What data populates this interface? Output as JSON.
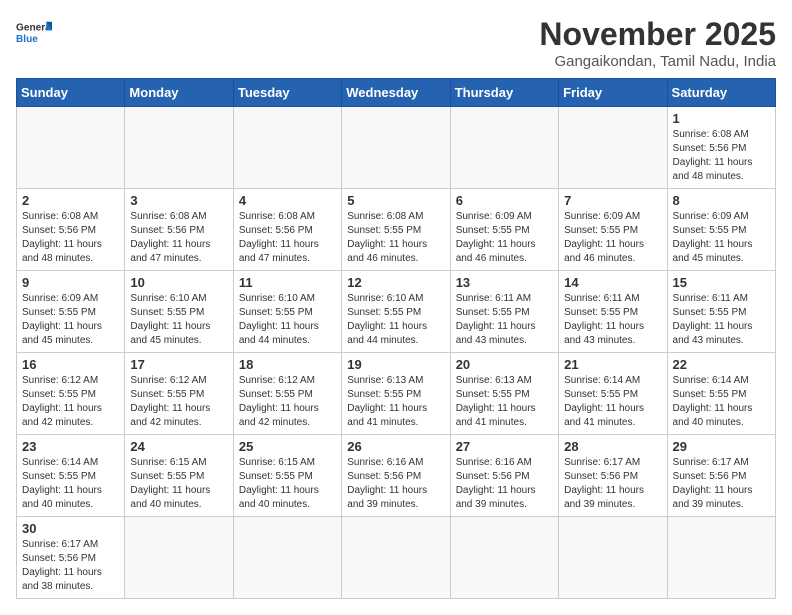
{
  "header": {
    "logo_general": "General",
    "logo_blue": "Blue",
    "month_title": "November 2025",
    "location": "Gangaikondan, Tamil Nadu, India"
  },
  "weekdays": [
    "Sunday",
    "Monday",
    "Tuesday",
    "Wednesday",
    "Thursday",
    "Friday",
    "Saturday"
  ],
  "weeks": [
    [
      {
        "day": "",
        "info": ""
      },
      {
        "day": "",
        "info": ""
      },
      {
        "day": "",
        "info": ""
      },
      {
        "day": "",
        "info": ""
      },
      {
        "day": "",
        "info": ""
      },
      {
        "day": "",
        "info": ""
      },
      {
        "day": "1",
        "info": "Sunrise: 6:08 AM\nSunset: 5:56 PM\nDaylight: 11 hours\nand 48 minutes."
      }
    ],
    [
      {
        "day": "2",
        "info": "Sunrise: 6:08 AM\nSunset: 5:56 PM\nDaylight: 11 hours\nand 48 minutes."
      },
      {
        "day": "3",
        "info": "Sunrise: 6:08 AM\nSunset: 5:56 PM\nDaylight: 11 hours\nand 47 minutes."
      },
      {
        "day": "4",
        "info": "Sunrise: 6:08 AM\nSunset: 5:56 PM\nDaylight: 11 hours\nand 47 minutes."
      },
      {
        "day": "5",
        "info": "Sunrise: 6:08 AM\nSunset: 5:55 PM\nDaylight: 11 hours\nand 46 minutes."
      },
      {
        "day": "6",
        "info": "Sunrise: 6:09 AM\nSunset: 5:55 PM\nDaylight: 11 hours\nand 46 minutes."
      },
      {
        "day": "7",
        "info": "Sunrise: 6:09 AM\nSunset: 5:55 PM\nDaylight: 11 hours\nand 46 minutes."
      },
      {
        "day": "8",
        "info": "Sunrise: 6:09 AM\nSunset: 5:55 PM\nDaylight: 11 hours\nand 45 minutes."
      }
    ],
    [
      {
        "day": "9",
        "info": "Sunrise: 6:09 AM\nSunset: 5:55 PM\nDaylight: 11 hours\nand 45 minutes."
      },
      {
        "day": "10",
        "info": "Sunrise: 6:10 AM\nSunset: 5:55 PM\nDaylight: 11 hours\nand 45 minutes."
      },
      {
        "day": "11",
        "info": "Sunrise: 6:10 AM\nSunset: 5:55 PM\nDaylight: 11 hours\nand 44 minutes."
      },
      {
        "day": "12",
        "info": "Sunrise: 6:10 AM\nSunset: 5:55 PM\nDaylight: 11 hours\nand 44 minutes."
      },
      {
        "day": "13",
        "info": "Sunrise: 6:11 AM\nSunset: 5:55 PM\nDaylight: 11 hours\nand 43 minutes."
      },
      {
        "day": "14",
        "info": "Sunrise: 6:11 AM\nSunset: 5:55 PM\nDaylight: 11 hours\nand 43 minutes."
      },
      {
        "day": "15",
        "info": "Sunrise: 6:11 AM\nSunset: 5:55 PM\nDaylight: 11 hours\nand 43 minutes."
      }
    ],
    [
      {
        "day": "16",
        "info": "Sunrise: 6:12 AM\nSunset: 5:55 PM\nDaylight: 11 hours\nand 42 minutes."
      },
      {
        "day": "17",
        "info": "Sunrise: 6:12 AM\nSunset: 5:55 PM\nDaylight: 11 hours\nand 42 minutes."
      },
      {
        "day": "18",
        "info": "Sunrise: 6:12 AM\nSunset: 5:55 PM\nDaylight: 11 hours\nand 42 minutes."
      },
      {
        "day": "19",
        "info": "Sunrise: 6:13 AM\nSunset: 5:55 PM\nDaylight: 11 hours\nand 41 minutes."
      },
      {
        "day": "20",
        "info": "Sunrise: 6:13 AM\nSunset: 5:55 PM\nDaylight: 11 hours\nand 41 minutes."
      },
      {
        "day": "21",
        "info": "Sunrise: 6:14 AM\nSunset: 5:55 PM\nDaylight: 11 hours\nand 41 minutes."
      },
      {
        "day": "22",
        "info": "Sunrise: 6:14 AM\nSunset: 5:55 PM\nDaylight: 11 hours\nand 40 minutes."
      }
    ],
    [
      {
        "day": "23",
        "info": "Sunrise: 6:14 AM\nSunset: 5:55 PM\nDaylight: 11 hours\nand 40 minutes."
      },
      {
        "day": "24",
        "info": "Sunrise: 6:15 AM\nSunset: 5:55 PM\nDaylight: 11 hours\nand 40 minutes."
      },
      {
        "day": "25",
        "info": "Sunrise: 6:15 AM\nSunset: 5:55 PM\nDaylight: 11 hours\nand 40 minutes."
      },
      {
        "day": "26",
        "info": "Sunrise: 6:16 AM\nSunset: 5:56 PM\nDaylight: 11 hours\nand 39 minutes."
      },
      {
        "day": "27",
        "info": "Sunrise: 6:16 AM\nSunset: 5:56 PM\nDaylight: 11 hours\nand 39 minutes."
      },
      {
        "day": "28",
        "info": "Sunrise: 6:17 AM\nSunset: 5:56 PM\nDaylight: 11 hours\nand 39 minutes."
      },
      {
        "day": "29",
        "info": "Sunrise: 6:17 AM\nSunset: 5:56 PM\nDaylight: 11 hours\nand 39 minutes."
      }
    ],
    [
      {
        "day": "30",
        "info": "Sunrise: 6:17 AM\nSunset: 5:56 PM\nDaylight: 11 hours\nand 38 minutes."
      },
      {
        "day": "",
        "info": ""
      },
      {
        "day": "",
        "info": ""
      },
      {
        "day": "",
        "info": ""
      },
      {
        "day": "",
        "info": ""
      },
      {
        "day": "",
        "info": ""
      },
      {
        "day": "",
        "info": ""
      }
    ]
  ]
}
